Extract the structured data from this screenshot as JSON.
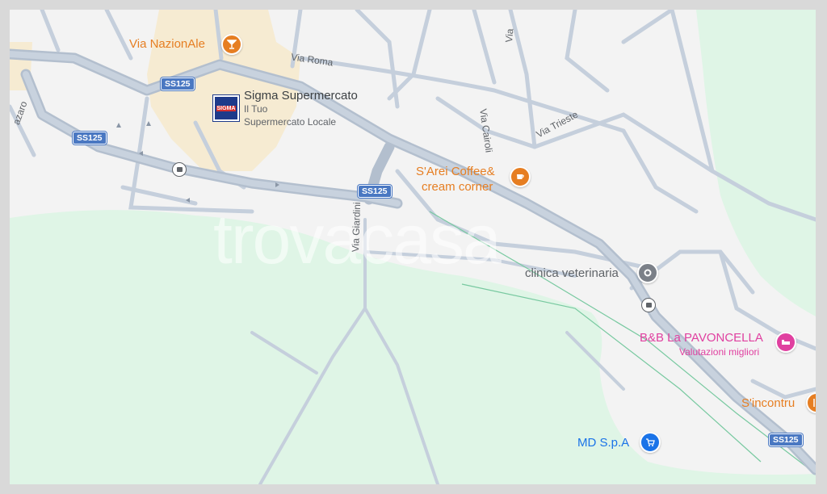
{
  "colors": {
    "land": "#f3f3f3",
    "park": "#dff5e6",
    "urban": "#f6ebd2",
    "road": "#c5cfdc",
    "road_major": "#b3bfce",
    "shield": "#4a78c2",
    "food": "#e67e22",
    "health": "#5f6368",
    "lodging": "#e040a0",
    "shop": "#1a73e8",
    "transit": "#5f6368"
  },
  "watermark": "trovacasa",
  "roads": [
    {
      "name": "Via Roma"
    },
    {
      "name": "Via Cairoli"
    },
    {
      "name": "Via Trieste"
    },
    {
      "name": "Via Giardini"
    },
    {
      "name": "azaro"
    },
    {
      "name": "Via"
    }
  ],
  "shields": [
    "SS125",
    "SS125",
    "SS125",
    "SS125"
  ],
  "pois": {
    "nazionale": {
      "name": "Via NazionAle",
      "icon": "cocktail-icon"
    },
    "sigma": {
      "name": "Sigma Supermercato",
      "sub1": "Il Tuo",
      "sub2": "Supermercato Locale",
      "logo": "SIGMA",
      "icon": "supermarket-logo"
    },
    "sarei": {
      "name1": "S'Arei Coffee&",
      "name2": "cream corner",
      "icon": "coffee-icon"
    },
    "clinica": {
      "name": "clinica veterinaria",
      "icon": "place-icon"
    },
    "bnb": {
      "name": "B&B La PAVONCELLA",
      "sub": "Valutazioni migliori",
      "icon": "bed-icon"
    },
    "sincontru": {
      "name": "S'incontru",
      "icon": "restaurant-icon"
    },
    "md": {
      "name": "MD S.p.A",
      "icon": "cart-icon"
    }
  },
  "transit_icons": [
    "bus-stop-icon",
    "bus-stop-icon"
  ]
}
